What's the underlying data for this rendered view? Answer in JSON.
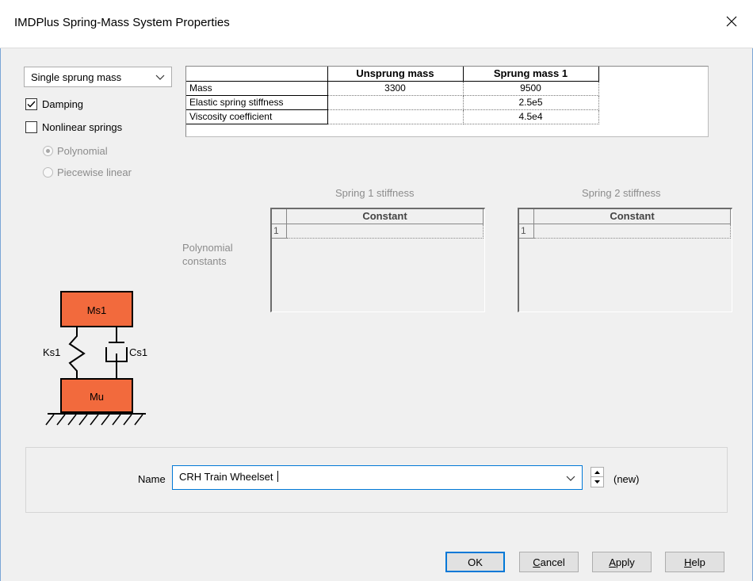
{
  "window": {
    "title": "IMDPlus Spring-Mass System Properties"
  },
  "model_type": {
    "selected": "Single sprung mass"
  },
  "options": {
    "damping": {
      "label": "Damping",
      "checked": true
    },
    "nonlinear": {
      "label": "Nonlinear springs",
      "checked": false
    },
    "polynomial": {
      "label": "Polynomial",
      "selected": true,
      "enabled": false
    },
    "piecewise": {
      "label": "Piecewise linear",
      "selected": false,
      "enabled": false
    }
  },
  "mass_table": {
    "columns": [
      "Unsprung mass",
      "Sprung mass 1"
    ],
    "rows": [
      {
        "label": "Mass",
        "values": [
          "3300",
          "9500"
        ]
      },
      {
        "label": "Elastic spring stiffness",
        "values": [
          "",
          "2.5e5"
        ]
      },
      {
        "label": "Viscosity coefficient",
        "values": [
          "",
          "4.5e4"
        ]
      }
    ]
  },
  "springs": {
    "group_label": "Polynomial constants",
    "spring1": {
      "title": "Spring 1 stiffness",
      "column": "Constant",
      "row_number": "1"
    },
    "spring2": {
      "title": "Spring 2 stiffness",
      "column": "Constant",
      "row_number": "1"
    }
  },
  "diagram": {
    "sprung_label": "Ms1",
    "unsprung_label": "Mu",
    "spring_label": "Ks1",
    "damper_label": "Cs1",
    "mass_color": "#f26a3d"
  },
  "name_field": {
    "label": "Name",
    "value": "CRH Train Wheelset ",
    "status": "(new)"
  },
  "buttons": {
    "ok": "OK",
    "cancel_prefix": "",
    "cancel_ul": "C",
    "cancel_rest": "ancel",
    "apply_prefix": "",
    "apply_ul": "A",
    "apply_rest": "pply",
    "help_prefix": "",
    "help_ul": "H",
    "help_rest": "elp"
  }
}
